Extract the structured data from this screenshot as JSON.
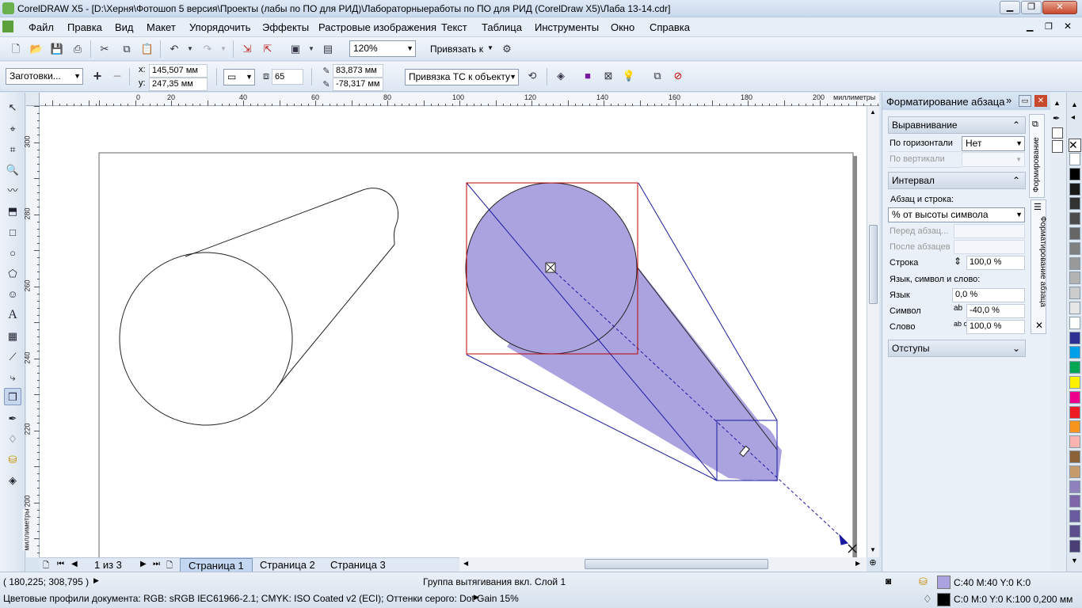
{
  "window": {
    "title": "CorelDRAW X5 - [D:\\Херня\\Фотошоп 5 версия\\Проекты (лабы по ПО для РИД)\\Лабораторныеработы по ПО для РИД (CorelDraw X5)\\Лаба 13-14.cdr]",
    "min": "▁",
    "max": "❐",
    "close": "✕"
  },
  "menu": [
    "Файл",
    "Правка",
    "Вид",
    "Макет",
    "Упорядочить",
    "Эффекты",
    "Растровые изображения",
    "Текст",
    "Таблица",
    "Инструменты",
    "Окно",
    "Справка"
  ],
  "toolbar": {
    "zoom": "120%",
    "snap": "Привязать к"
  },
  "propbar": {
    "preset": "Заготовки...",
    "x": "145,507 мм",
    "y": "247,35 мм",
    "depth": "65",
    "vp_x": "83,873 мм",
    "vp_y": "-78,317 мм",
    "vp_lock": "Привязка ТС к объекту"
  },
  "ruler": {
    "unit": "миллиметры",
    "top": [
      "0",
      "20",
      "40",
      "60",
      "80",
      "100",
      "120",
      "140",
      "160",
      "180",
      "200"
    ],
    "left": [
      "300",
      "280",
      "260",
      "240",
      "220",
      "200"
    ]
  },
  "pagebar": {
    "count": "1 из 3",
    "tabs": [
      "Страница 1",
      "Страница 2",
      "Страница 3"
    ]
  },
  "docker": {
    "title": "Форматирование абзаца",
    "align_hdr": "Выравнивание",
    "horiz_label": "По горизонтали",
    "horiz_value": "Нет",
    "vert_label": "По вертикали",
    "interval_hdr": "Интервал",
    "para_line": "Абзац и строка:",
    "para_unit": "% от высоты символа",
    "before": "Перед абзац...",
    "after": "После абзацев",
    "line_label": "Строка",
    "line_value": "100,0 %",
    "lang_hdr": "Язык, символ и слово:",
    "lang_label": "Язык",
    "lang_value": "0,0 %",
    "char_label": "Символ",
    "char_value": "-40,0 %",
    "word_label": "Слово",
    "word_value": "100,0 %",
    "indent_hdr": "Отступы",
    "vtab1": "Формирование",
    "vtab2": "Форматирование абзаца"
  },
  "palette": [
    "#ffffff",
    "#000000",
    "#1a1a1a",
    "#333333",
    "#4d4d4d",
    "#666666",
    "#808080",
    "#999999",
    "#b3b3b3",
    "#cccccc",
    "#e6e6e6",
    "#ffffff",
    "#2e3192",
    "#00a0e9",
    "#00a651",
    "#fff200",
    "#ec008c",
    "#ed1c24",
    "#f7941d",
    "#f9b4b0",
    "#8c6239",
    "#c69c6d",
    "#8f82bc",
    "#7f66a8",
    "#6a5b9e",
    "#5c4f8c",
    "#4a3f75"
  ],
  "status": {
    "coords": "( 180,225; 308,795 )",
    "info": "Группа вытягивания вкл. Слой 1",
    "profiles": "Цветовые профили документа: RGB: sRGB IEC61966-2.1; CMYK: ISO Coated v2 (ECI); Оттенки серого: Dot Gain 15%",
    "fill": "C:40 M:40 Y:0 K:0",
    "outline": "C:0 M:0 Y:0 K:100  0,200 мм",
    "fill_color": "#aaa3e0",
    "outline_color": "#000000"
  },
  "colors": {
    "accent": "#aaa3e0",
    "selection": "#c00000",
    "extrude_lines": "#1a1aa0"
  }
}
